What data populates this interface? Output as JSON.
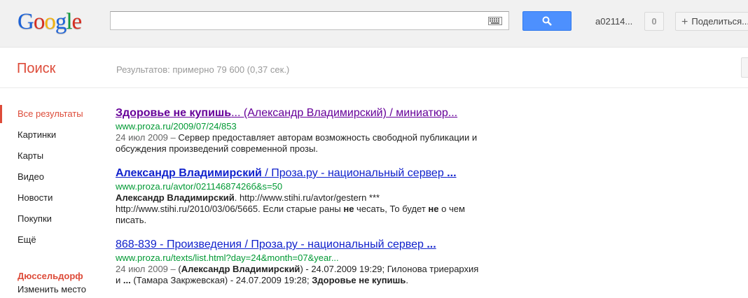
{
  "logo": {
    "letters": [
      {
        "ch": "G",
        "color": "#1d63d8"
      },
      {
        "ch": "o",
        "color": "#d62d20"
      },
      {
        "ch": "o",
        "color": "#f3b20d"
      },
      {
        "ch": "g",
        "color": "#1d63d8"
      },
      {
        "ch": "l",
        "color": "#129a3d"
      },
      {
        "ch": "e",
        "color": "#d62d20"
      }
    ]
  },
  "search": {
    "value": "",
    "placeholder": ""
  },
  "user": {
    "name": "a02114...",
    "notifications": "0"
  },
  "share": {
    "label": "Поделиться..."
  },
  "subheader": {
    "title": "Поиск",
    "stats": "Результатов: примерно 79 600 (0,37 сек.)"
  },
  "nav": {
    "items": [
      {
        "label": "Все результаты",
        "active": true
      },
      {
        "label": "Картинки"
      },
      {
        "label": "Карты"
      },
      {
        "label": "Видео"
      },
      {
        "label": "Новости"
      },
      {
        "label": "Покупки"
      },
      {
        "label": "Ещё"
      }
    ],
    "location_title": "Дюссельдорф",
    "location_change": "Изменить место"
  },
  "results": [
    {
      "title_bold": "Здоровье не купишь",
      "title_rest": "... (Александр Владимирский) / миниатюр...",
      "url": "www.proza.ru/2009/07/24/853",
      "date": "24 июл 2009 – ",
      "snippet": "Сервер предоставляет авторам возможность свободной публикации и обсуждения произведений современной прозы.",
      "visited": true
    },
    {
      "title_bold": "Александр Владимирский",
      "title_rest": " / Проза.ру - национальный сервер ",
      "title_tail": "...",
      "url": "www.proza.ru/avtor/02114687426б&s=50",
      "snippet_parts": [
        {
          "t": "Александр Владимирский",
          "b": true
        },
        {
          "t": ". http://www.stihi.ru/avtor/gestern *** http://www.stihi.ru/2010/03/06/5665. Если старые раны "
        },
        {
          "t": "не",
          "b": true
        },
        {
          "t": " чесать, То будет "
        },
        {
          "t": "не",
          "b": true
        },
        {
          "t": " о чем писать."
        }
      ],
      "visited": false
    },
    {
      "title_bold": "",
      "title_rest": "868-839 - Произведения / Проза.ру - национальный сервер ",
      "title_tail": "...",
      "url": "www.proza.ru/texts/list.html?day=24&month=07&year...",
      "date": "24 июл 2009 – ",
      "snippet_parts": [
        {
          "t": "("
        },
        {
          "t": "Александр Владимирский",
          "b": true
        },
        {
          "t": ") - 24.07.2009 19:29; Гилонова триерархия и "
        },
        {
          "t": "...",
          "b": true
        },
        {
          "t": " (Тамара Закржевская) - 24.07.2009 19:28; "
        },
        {
          "t": "Здоровье не купишь",
          "b": true
        },
        {
          "t": "."
        }
      ],
      "visited": false
    }
  ]
}
